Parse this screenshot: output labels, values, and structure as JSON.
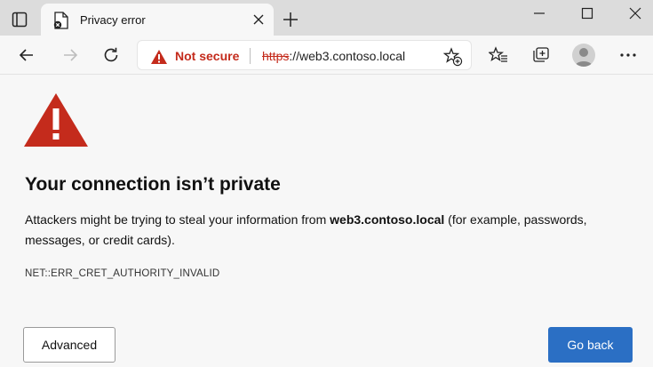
{
  "colors": {
    "danger": "#c42b1c",
    "primary_button": "#2b6fc4",
    "tabbar": "#dcdcdc",
    "page_bg": "#f7f7f7"
  },
  "tab": {
    "title": "Privacy error",
    "favicon_icon": "broken-page-icon",
    "close_icon": "close-icon"
  },
  "window": {
    "minimize_icon": "minimize-icon",
    "maximize_icon": "maximize-icon",
    "close_icon": "close-icon"
  },
  "toolbar": {
    "back_icon": "back-arrow-icon",
    "forward_icon": "forward-arrow-icon",
    "refresh_icon": "refresh-icon",
    "security_label": "Not secure",
    "url_scheme": "https",
    "url_rest": "://web3.contoso.local",
    "favorites_icon": "favorites-icon",
    "collections_icon": "collections-icon",
    "profile_icon": "profile-avatar-icon",
    "more_icon": "more-icon"
  },
  "error_page": {
    "headline": "Your connection isn’t private",
    "description_before": "Attackers might be trying to steal your information from ",
    "description_host": "web3.contoso.local",
    "description_after": " (for example, passwords, messages, or credit cards).",
    "error_code": "NET::ERR_CRET_AUTHORITY_INVALID",
    "advanced_label": "Advanced",
    "go_back_label": "Go back"
  }
}
